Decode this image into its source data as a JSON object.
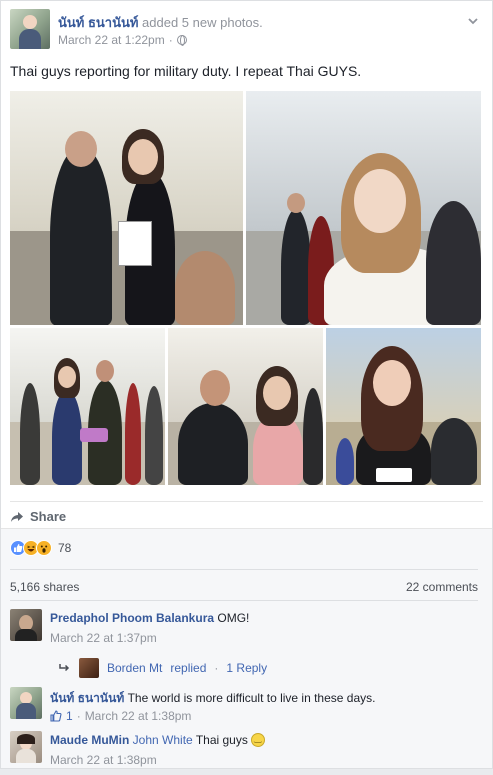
{
  "post": {
    "author": "นันท์ ธนานันท์",
    "action": "added 5 new photos.",
    "date": "March 22 at 1:22pm",
    "separator": "·",
    "text": "Thai guys reporting for military duty. I repeat Thai GUYS."
  },
  "photos": [
    {
      "alt": "photo-1"
    },
    {
      "alt": "photo-2"
    },
    {
      "alt": "photo-3"
    },
    {
      "alt": "photo-4"
    },
    {
      "alt": "photo-5"
    }
  ],
  "actions": {
    "share_label": "Share"
  },
  "reactions": {
    "count": "78",
    "types": [
      "like-icon",
      "haha-icon",
      "wow-icon"
    ]
  },
  "counts": {
    "shares": "5,166 shares",
    "comments": "22 comments"
  },
  "comments": [
    {
      "author": "Predaphol Phoom Balankura",
      "text": "OMG!",
      "time": "March 22 at 1:37pm",
      "reply": {
        "author": "Borden Mt",
        "replied": "replied",
        "separator": "·",
        "count": "1 Reply"
      }
    },
    {
      "author": "นันท์ ธนานันท์",
      "text": "The world is more difficult to live in these days.",
      "likes": "1",
      "separator": "·",
      "time": "March 22 at 1:38pm"
    },
    {
      "author": "Maude MuMin",
      "mention": "John White",
      "text": "Thai guys",
      "time": "March 22 at 1:38pm"
    }
  ],
  "colors": {
    "link": "#365899",
    "muted": "#90949c",
    "like": "#5890ff",
    "haha": "#f7b125"
  }
}
